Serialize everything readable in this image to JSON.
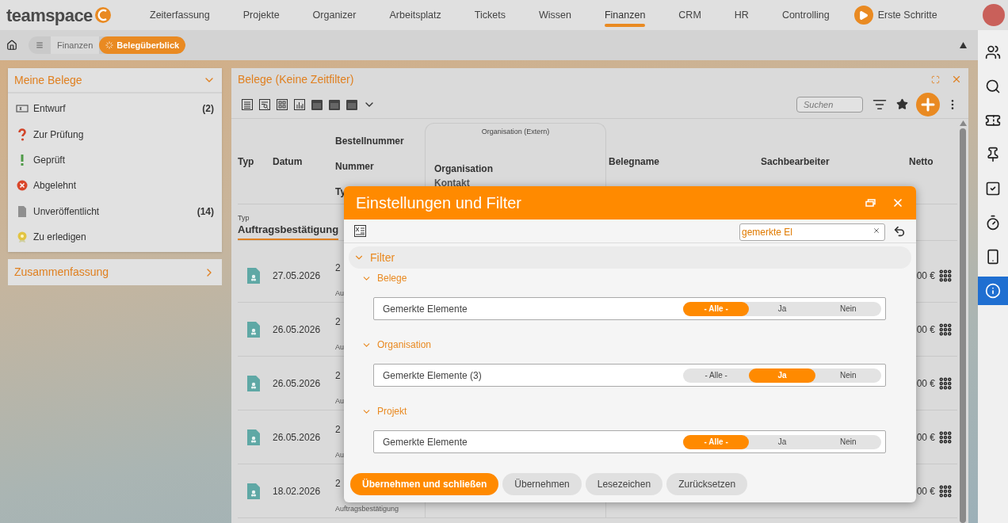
{
  "top_nav": {
    "logo": "teamspace",
    "items": [
      {
        "label": "Zeiterfassung",
        "selected": false
      },
      {
        "label": "Projekte",
        "selected": false
      },
      {
        "label": "Organizer",
        "selected": false
      },
      {
        "label": "Arbeitsplatz",
        "selected": false
      },
      {
        "label": "Tickets",
        "selected": false
      },
      {
        "label": "Wissen",
        "selected": false
      },
      {
        "label": "Finanzen",
        "selected": true
      },
      {
        "label": "CRM",
        "selected": false
      },
      {
        "label": "HR",
        "selected": false
      },
      {
        "label": "Controlling",
        "selected": false
      }
    ],
    "start_button": "Erste Schritte"
  },
  "breadcrumb": [
    {
      "label": "Finanzen",
      "selected": false
    },
    {
      "label": "Belegüberblick",
      "selected": true
    }
  ],
  "sidebar": {
    "title": "Meine Belege",
    "expanded": true,
    "items": [
      {
        "kind": "draft",
        "label": "Entwurf",
        "count": "(2)"
      },
      {
        "kind": "review",
        "label": "Zur Prüfung"
      },
      {
        "kind": "approved",
        "label": "Geprüft"
      },
      {
        "kind": "rejected",
        "label": "Abgelehnt"
      },
      {
        "kind": "unpublished",
        "label": "Unveröffentlicht",
        "count": "(14)"
      },
      {
        "kind": "todo",
        "label": "Zu erledigen"
      }
    ],
    "summary": {
      "title": "Zusammenfassung",
      "expanded": false
    }
  },
  "panel": {
    "title": "Belege (Keine Zeitfilter)",
    "search": {
      "placeholder": "Suchen"
    },
    "table": {
      "group_header": "Organisation (Extern)",
      "columns": {
        "typ": "Typ",
        "datum": "Datum",
        "nummer": [
          "Bestellnummer",
          "Nummer",
          "Ty"
        ],
        "organisation": [
          "Organisation",
          "Kontakt"
        ],
        "belegname": "Belegname",
        "sachbearbeiter": "Sachbearbeiter",
        "netto": "Netto"
      },
      "group": {
        "label": "Typ",
        "value": "Auftragsbestätigung"
      },
      "rows": [
        {
          "datum": "27.05.2026",
          "nummer": "2",
          "sub": "Au",
          "netto": "00 €"
        },
        {
          "datum": "26.05.2026",
          "nummer": "2",
          "sub": "Au",
          "netto": "00 €"
        },
        {
          "datum": "26.05.2026",
          "nummer": "2",
          "sub": "Au",
          "netto": "00 €"
        },
        {
          "datum": "26.05.2026",
          "nummer": "2",
          "sub": "Au",
          "netto": "00 €"
        },
        {
          "datum": "18.02.2026",
          "nummer": "2",
          "sub": "Auftragsbestätigung",
          "netto": "00 €"
        }
      ]
    }
  },
  "dialog": {
    "title": "Einstellungen und Filter",
    "search": {
      "value": "gemerkte El"
    },
    "section": {
      "label": "Filter",
      "expanded": true
    },
    "groups": [
      {
        "label": "Belege",
        "expanded": true,
        "filter": "Gemerkte Elemente",
        "options": [
          {
            "label": "- Alle -",
            "selected": true
          },
          {
            "label": "Ja",
            "selected": false
          },
          {
            "label": "Nein",
            "selected": false
          }
        ]
      },
      {
        "label": "Organisation",
        "expanded": true,
        "filter": "Gemerkte Elemente (3)",
        "options": [
          {
            "label": "- Alle -",
            "selected": false
          },
          {
            "label": "Ja",
            "selected": true
          },
          {
            "label": "Nein",
            "selected": false
          }
        ]
      },
      {
        "label": "Projekt",
        "expanded": true,
        "filter": "Gemerkte Elemente",
        "options": [
          {
            "label": "- Alle -",
            "selected": true
          },
          {
            "label": "Ja",
            "selected": false
          },
          {
            "label": "Nein",
            "selected": false
          }
        ]
      }
    ],
    "buttons": [
      {
        "label": "Übernehmen und schließen",
        "kind": "primary"
      },
      {
        "label": "Übernehmen",
        "kind": "secondary"
      },
      {
        "label": "Lesezeichen",
        "kind": "secondary"
      },
      {
        "label": "Zurücksetzen",
        "kind": "secondary"
      }
    ]
  },
  "right_rail": [
    {
      "kind": "people",
      "selected": false
    },
    {
      "kind": "search",
      "selected": false
    },
    {
      "kind": "ticket",
      "selected": false
    },
    {
      "kind": "pin",
      "selected": false
    },
    {
      "kind": "tasks",
      "selected": false
    },
    {
      "kind": "timer",
      "selected": false
    },
    {
      "kind": "phone",
      "selected": false
    },
    {
      "kind": "info",
      "selected": true
    }
  ]
}
